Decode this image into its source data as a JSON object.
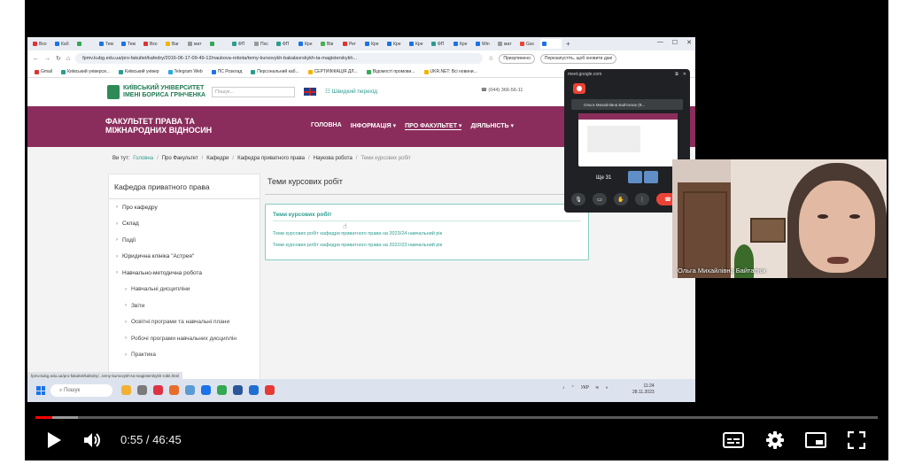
{
  "browser": {
    "tabs": [
      "Вхо",
      "Каб",
      "",
      "Тем",
      "Тем",
      "Вхо",
      "Ваг",
      "мат",
      "",
      "ФП",
      "Пос",
      "ФП",
      "Кре",
      "Вів",
      "Рег",
      "Кре",
      "Кре",
      "Кре",
      "ФП",
      "Кре",
      "Win",
      "мат",
      "Gss",
      ""
    ],
    "url": "fpmv.kubg.edu.ua/pro-fakultet/kafedry/2016-06-17-09-49-12/naukova-robota/temy-kursovykh-bakalavrskykh-ta-magisterskykh...",
    "profile_label": "Призупинено",
    "update_label": "Перезапустіть, щоб оновити дані",
    "bookmarks": [
      "Gmail",
      "Київський універси...",
      "Київський універ",
      "Telegram Web",
      "ПС Розклад",
      "Персональний каб...",
      "СЕРТИФІКАЦІЯ ДЛ...",
      "Відомості промови...",
      "UKR.NET: Всі новини..."
    ]
  },
  "site": {
    "logo_text": "КИЇВСЬКИЙ УНІВЕРСИТЕТ ІМЕНІ БОРИСА ГРІНЧЕНКА",
    "search_placeholder": "Пошук...",
    "quick_link": "Швидкий перехід",
    "phone": "(044) 366-56-11",
    "faculty": "ФАКУЛЬТЕТ ПРАВА ТА МІЖНАРОДНИХ ВІДНОСИН",
    "nav": [
      "ГОЛОВНА",
      "ІНФОРМАЦІЯ",
      "ПРО ФАКУЛЬТЕТ",
      "ДІЯЛЬНІСТЬ"
    ],
    "breadcrumb_prefix": "Ви тут:",
    "breadcrumb": [
      "Головна",
      "Про Факультет",
      "Кафедри",
      "Кафедра приватного права",
      "Наукова робота",
      "Теми курсових робіт"
    ],
    "sidebar_title": "Кафедра приватного права",
    "sidebar_items": [
      {
        "label": "Про кафедру",
        "sub": false
      },
      {
        "label": "Склад",
        "sub": false
      },
      {
        "label": "Події",
        "sub": false
      },
      {
        "label": "Юридична клініка \"Астрея\"",
        "sub": false
      },
      {
        "label": "Навчально-методична робота",
        "sub": false
      },
      {
        "label": "Навчальні дисципліни",
        "sub": true
      },
      {
        "label": "Звіти",
        "sub": true
      },
      {
        "label": "Освітні програми та навчальні плани",
        "sub": true
      },
      {
        "label": "Робочі програми навчальних дисциплін",
        "sub": true
      },
      {
        "label": "Практика",
        "sub": true
      }
    ],
    "main_title": "Теми курсових робіт",
    "card_title": "Теми курсових робіт",
    "card_links": [
      "Теми курсових робіт кафедри приватного права на 2023/24 навчальний рік",
      "Теми курсових робіт кафедри приватного права на 2022/23 навчальний рік"
    ],
    "status_url": "fpmv.kubg.edu.ua/pro-fakultet/kafedry/...temy-kursovykh-ta-magisterskykh-robit.html"
  },
  "taskbar": {
    "search_placeholder": "Пошук",
    "lang": "УКР",
    "time": "11:24",
    "date": "28.11.2023"
  },
  "meet": {
    "url": "meet.google.com",
    "participant": "Ольга Михайлівна Байталюк (В...",
    "time": "Ще 31"
  },
  "webcam": {
    "name": "Ольга Михайлівна Байталюк"
  },
  "player": {
    "time": "0:55 / 46:45",
    "progress_fraction": 0.0196,
    "buffered_fraction": 0.05
  },
  "colors": {
    "brand_maroon": "#8b2d5c",
    "brand_green": "#2a9d8f",
    "progress_red": "#ff0000"
  }
}
